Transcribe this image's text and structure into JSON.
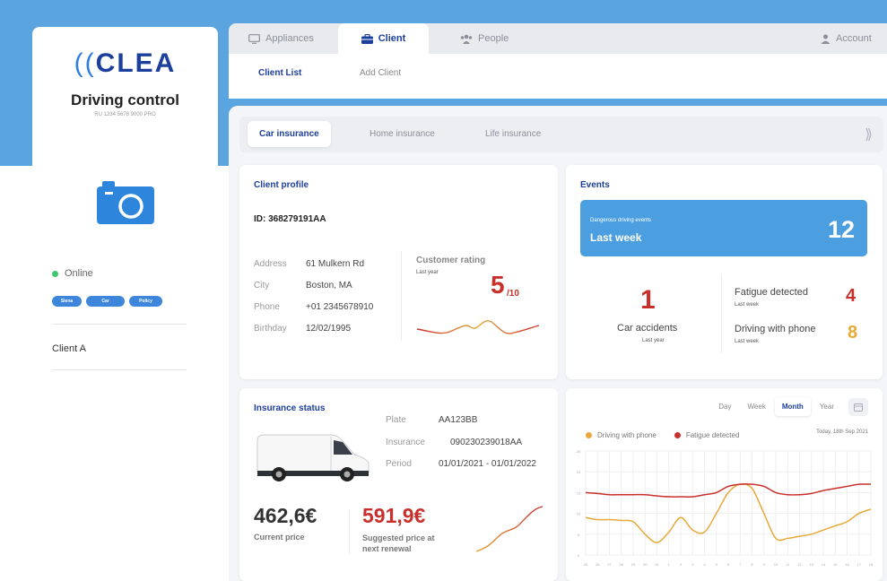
{
  "brand": {
    "logo_text": "CLEA",
    "app_title": "Driving control",
    "serial": "RU 1234 5678 9000 PRO"
  },
  "left_panel": {
    "status": "Online",
    "tags": [
      "Siena",
      "Car",
      "Policy"
    ],
    "client": "Client A"
  },
  "top_tabs": [
    "Appliances",
    "Client",
    "People",
    "Account"
  ],
  "sub_tabs": [
    "Client List",
    "Add Client"
  ],
  "insurance_tabs": [
    "Car insurance",
    "Home insurance",
    "Life insurance"
  ],
  "profile": {
    "title": "Client profile",
    "id": "ID: 368279191AA",
    "fields": [
      {
        "label": "Address",
        "value": "61 Mulkern Rd"
      },
      {
        "label": "City",
        "value": "Boston, MA"
      },
      {
        "label": "Phone",
        "value": "+01 2345678910"
      },
      {
        "label": "Birthday",
        "value": "12/02/1995"
      }
    ],
    "rating_title": "Customer rating",
    "rating_sub": "Last year",
    "rating_value": "5",
    "rating_denominator": "/10"
  },
  "events": {
    "title": "Events",
    "danger_label": "Dangerous driving events",
    "danger_period": "Last week",
    "danger_count": "12",
    "accidents_count": "1",
    "accidents_label": "Car accidents",
    "accidents_sub": "Last year",
    "fatigue_label": "Fatigue detected",
    "fatigue_sub": "Last week",
    "fatigue_count": "4",
    "phone_label": "Driving with phone",
    "phone_sub": "Last week",
    "phone_count": "8"
  },
  "insurance": {
    "title": "Insurance status",
    "fields": [
      {
        "label": "Plate",
        "value": "AA123BB"
      },
      {
        "label": "Insurance",
        "value": "090230239018AA"
      },
      {
        "label": "Period",
        "value": "01/01/2021 - 01/01/2022"
      }
    ],
    "current_price": "462,6€",
    "current_label": "Current price",
    "suggested_price": "591,9€",
    "suggested_label_1": "Suggested price at",
    "suggested_label_2": "next renewal"
  },
  "chart_panel": {
    "ranges": [
      "Day",
      "Week",
      "Month",
      "Year"
    ],
    "active_range": "Month",
    "date_label": "Today, 18th Sep 2021"
  },
  "colors": {
    "accent": "#1d3f9c",
    "blue": "#4b9fe0",
    "red": "#c9302c",
    "orange": "#e9a93a",
    "online": "#3ec66a"
  },
  "chart_data": {
    "type": "line",
    "x": [
      "25",
      "26",
      "27",
      "28",
      "29",
      "30",
      "31",
      "1",
      "2",
      "3",
      "4",
      "5",
      "6",
      "7",
      "8",
      "9",
      "10",
      "11",
      "12",
      "13",
      "14",
      "15",
      "16",
      "17",
      "18"
    ],
    "ylim": [
      0,
      25
    ],
    "yticks": [
      "25",
      "20",
      "15",
      "10",
      "5",
      "0"
    ],
    "series": [
      {
        "name": "Driving with phone",
        "color": "#e9a93a",
        "values": [
          9,
          8.5,
          8.5,
          8.3,
          8,
          5,
          3,
          5.5,
          9,
          6,
          5.5,
          10,
          15,
          17,
          16,
          10,
          4,
          4,
          4.5,
          5,
          6,
          7,
          8,
          10,
          11
        ]
      },
      {
        "name": "Fatigue detected",
        "color": "#c9302c",
        "values": [
          15,
          14.8,
          14.5,
          14.5,
          14.5,
          14.5,
          14.2,
          14,
          14,
          14,
          14.5,
          15,
          16.5,
          17,
          17,
          16.5,
          15,
          14.5,
          14.5,
          14.8,
          15.5,
          16,
          16.5,
          17,
          17
        ]
      }
    ]
  }
}
